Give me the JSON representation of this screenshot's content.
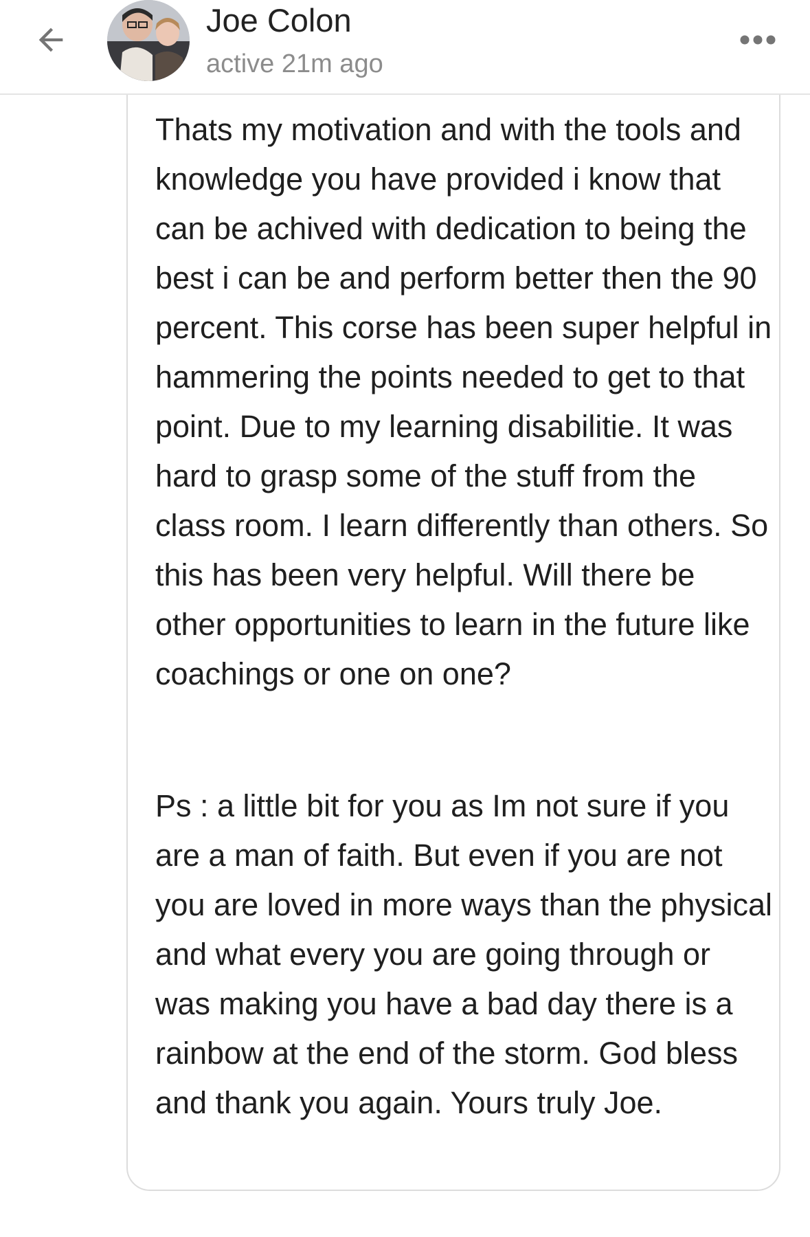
{
  "header": {
    "back_icon": "arrow-left-icon",
    "contact_name": "Joe Colon",
    "status": "active 21m ago",
    "more_icon": "more-horizontal-icon"
  },
  "message": {
    "paragraphs": [
      "Thats my motivation and with the tools and knowledge you have provided i know that can be achived with dedication to being the best i can be and perform better then the 90 percent. This corse has been super helpful in hammering the points needed to get to that point. Due to my learning disabilitie. It was hard to grasp some of the stuff from the class room. I learn differently than others. So this has been very helpful. Will there be other opportunities to learn in the future like coachings or one on one?",
      "Ps : a little bit for you as Im not sure if you are a man of faith. But even if you are not you are loved in more ways than the physical and what every you are going through or was making you have a bad day there is a rainbow at the end of the storm. God bless and thank you again. Yours truly Joe."
    ]
  },
  "colors": {
    "name": "#222222",
    "status": "#8c8c8c",
    "icon": "#757575",
    "bubble_border": "#dcdcdc",
    "divider": "#e4e4e4"
  }
}
